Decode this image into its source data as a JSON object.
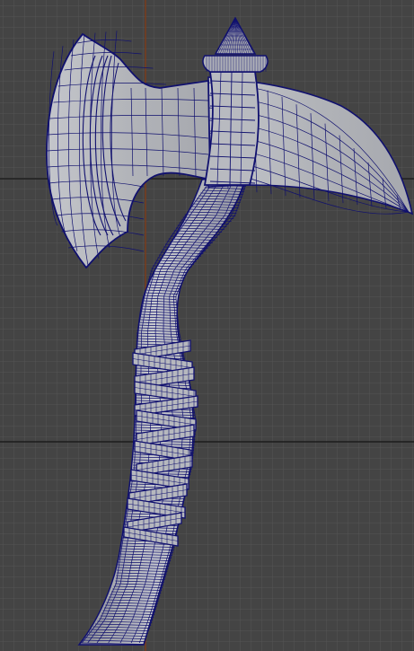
{
  "viewport": {
    "kind": "modeling-viewport-ortho-side",
    "colors": {
      "background": "#444444",
      "grid_minor": "#555555",
      "grid_major": "#202020",
      "axis_vertical": "#7a3c1c",
      "mesh_fill": "#b4b6bb",
      "mesh_fill_shadow": "#9a9ca2",
      "wireframe": "#10106e",
      "wireframe_dense": "#1a1aa0"
    }
  },
  "model": {
    "parts": [
      "axe-blade",
      "axe-beard",
      "axe-poll-socket",
      "pommel-spike",
      "handle",
      "leather-wrap"
    ]
  }
}
